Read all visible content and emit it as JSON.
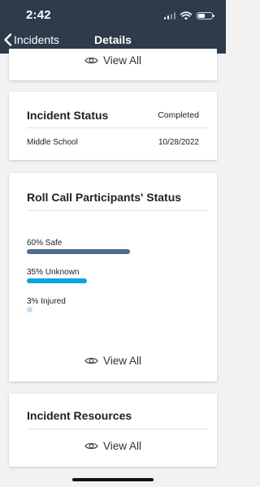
{
  "status_bar": {
    "time": "2:42"
  },
  "nav": {
    "back_label": "Incidents",
    "title": "Details"
  },
  "top_card": {
    "view_all": "View All"
  },
  "incident_status": {
    "title": "Incident Status",
    "status": "Completed",
    "location": "Middle School",
    "date": "10/28/2022"
  },
  "roll_call": {
    "title": "Roll Call Participants' Status",
    "items": [
      {
        "label": "60% Safe",
        "percent": 60,
        "color": "#4f6a8f"
      },
      {
        "label": "35% Unknown",
        "percent": 35,
        "color": "#0aa5dc"
      },
      {
        "label": "3% Injured",
        "percent": 3,
        "color": "#c7dcec"
      }
    ],
    "view_all": "View All"
  },
  "resources": {
    "title": "Incident Resources",
    "view_all": "View All"
  }
}
